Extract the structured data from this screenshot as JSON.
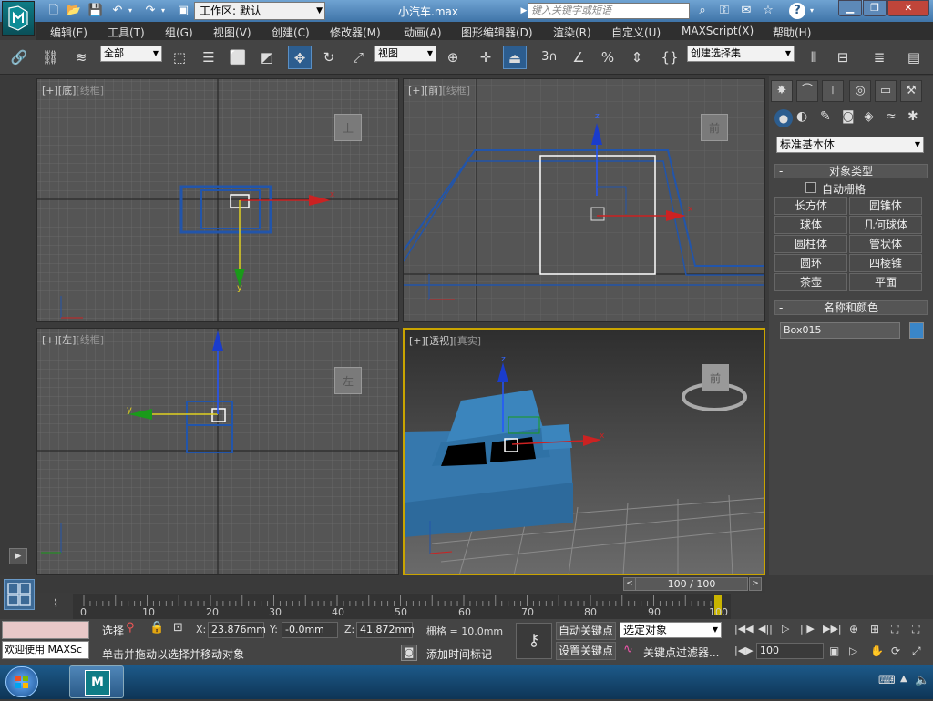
{
  "title": {
    "workspace_label": "工作区: 默认",
    "filename": "小汽车.max",
    "search_placeholder": "键入关键字或短语"
  },
  "menu": [
    "编辑(E)",
    "工具(T)",
    "组(G)",
    "视图(V)",
    "创建(C)",
    "修改器(M)",
    "动画(A)",
    "图形编辑器(D)",
    "渲染(R)",
    "自定义(U)",
    "MAXScript(X)",
    "帮助(H)"
  ],
  "toolbar": {
    "selection_filter": "全部",
    "ref_coord": "视图",
    "snap_3": "3",
    "named_selection": "创建选择集"
  },
  "viewports": {
    "top": {
      "label_plus": "[+]",
      "label_view": "[底]",
      "label_shade": "[线框]",
      "cube": "上"
    },
    "front": {
      "label_plus": "[+]",
      "label_view": "[前]",
      "label_shade": "[线框]",
      "cube": "前"
    },
    "left": {
      "label_plus": "[+]",
      "label_view": "[左]",
      "label_shade": "[线框]",
      "cube": "左"
    },
    "persp": {
      "label_plus": "[+]",
      "label_view": "[透视]",
      "label_shade": "[真实]",
      "cube": "前"
    }
  },
  "axes": {
    "x": "x",
    "y": "y",
    "z": "z"
  },
  "cmdpanel": {
    "category": "标准基本体",
    "object_type_title": "对象类型",
    "auto_grid": "自动栅格",
    "buttons": [
      "长方体",
      "圆锥体",
      "球体",
      "几何球体",
      "圆柱体",
      "管状体",
      "圆环",
      "四棱锥",
      "茶壶",
      "平面"
    ],
    "name_color_title": "名称和颜色",
    "object_name": "Box015",
    "object_color": "#3a86c8"
  },
  "timeline": {
    "slider": "100 / 100",
    "ticks": [
      "0",
      "10",
      "20",
      "30",
      "40",
      "50",
      "60",
      "70",
      "80",
      "90",
      "100"
    ]
  },
  "status": {
    "maxscript_prompt": "欢迎使用 MAXSc",
    "selection_label": "选择",
    "x_label": "X:",
    "x_value": "23.876mm",
    "y_label": "Y:",
    "y_value": "-0.0mm",
    "z_label": "Z:",
    "z_value": "41.872mm",
    "grid": "栅格 = 10.0mm",
    "prompt": "单击并拖动以选择并移动对象",
    "add_time_tag": "添加时间标记",
    "auto_key": "自动关键点",
    "set_key": "设置关键点",
    "key_mode": "选定对象",
    "key_filters": "关键点过滤器...",
    "frame": "100"
  },
  "colors": {
    "accent": "#2c5d8f",
    "selection_blue": "#2255aa"
  }
}
